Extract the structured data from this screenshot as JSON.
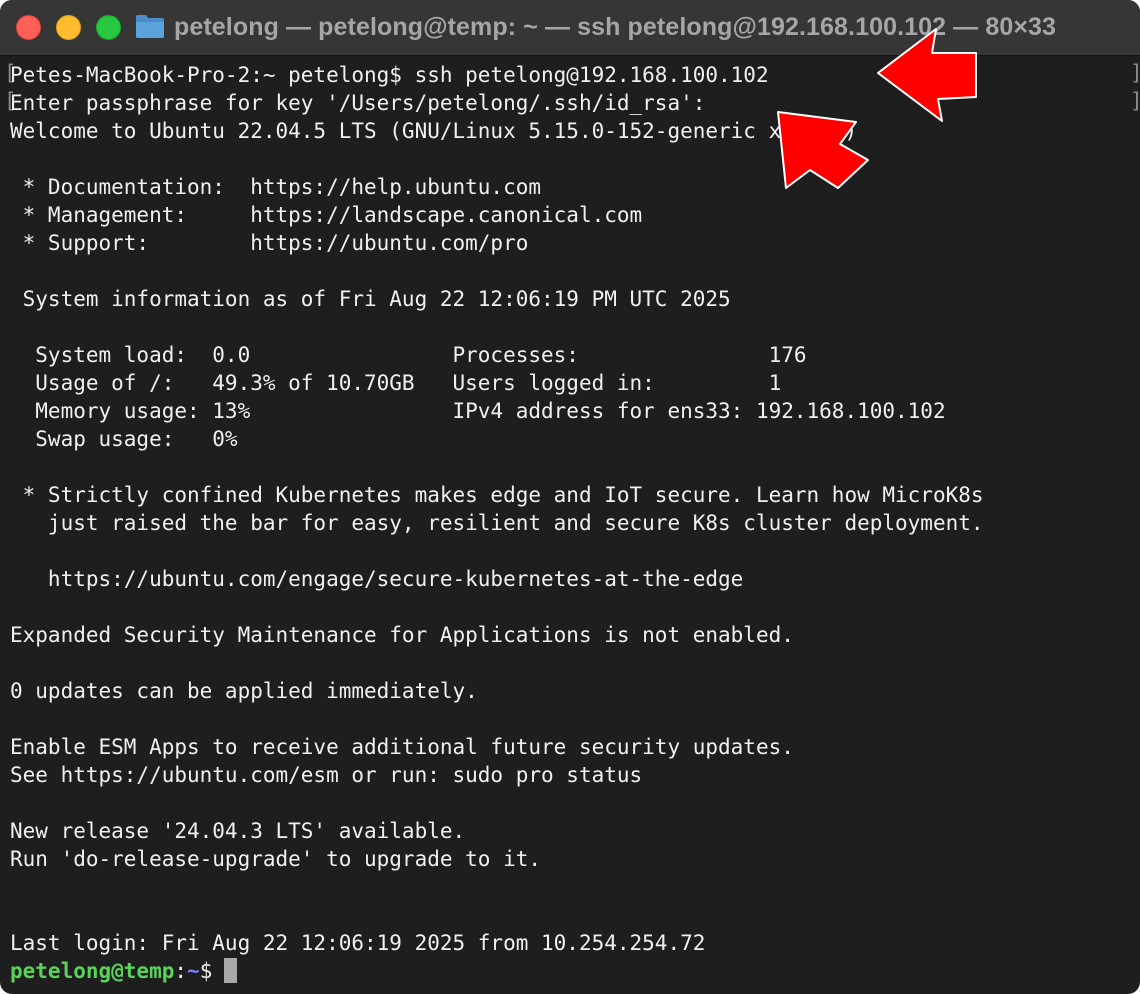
{
  "window": {
    "title": "petelong — petelong@temp: ~ — ssh petelong@192.168.100.102 — 80×33",
    "icon": "folder-icon",
    "accent_prompt_user": "#5ad35a",
    "accent_prompt_path": "#7b7bff",
    "annotation_arrow_color": "#ff0000"
  },
  "terminal": {
    "lines": [
      "Petes-MacBook-Pro-2:~ petelong$ ssh petelong@192.168.100.102",
      "Enter passphrase for key '/Users/petelong/.ssh/id_rsa':",
      "Welcome to Ubuntu 22.04.5 LTS (GNU/Linux 5.15.0-152-generic x86_64)",
      "",
      " * Documentation:  https://help.ubuntu.com",
      " * Management:     https://landscape.canonical.com",
      " * Support:        https://ubuntu.com/pro",
      "",
      " System information as of Fri Aug 22 12:06:19 PM UTC 2025",
      "",
      "  System load:  0.0                Processes:               176",
      "  Usage of /:   49.3% of 10.70GB   Users logged in:         1",
      "  Memory usage: 13%                IPv4 address for ens33: 192.168.100.102",
      "  Swap usage:   0%",
      "",
      " * Strictly confined Kubernetes makes edge and IoT secure. Learn how MicroK8s",
      "   just raised the bar for easy, resilient and secure K8s cluster deployment.",
      "",
      "   https://ubuntu.com/engage/secure-kubernetes-at-the-edge",
      "",
      "Expanded Security Maintenance for Applications is not enabled.",
      "",
      "0 updates can be applied immediately.",
      "",
      "Enable ESM Apps to receive additional future security updates.",
      "See https://ubuntu.com/esm or run: sudo pro status",
      "",
      "New release '24.04.3 LTS' available.",
      "Run 'do-release-upgrade' to upgrade to it.",
      "",
      "",
      "Last login: Fri Aug 22 12:06:19 2025 from 10.254.254.72"
    ],
    "prompt": {
      "user_host": "petelong@temp",
      "separator": ":",
      "path": "~",
      "symbol": "$"
    }
  }
}
